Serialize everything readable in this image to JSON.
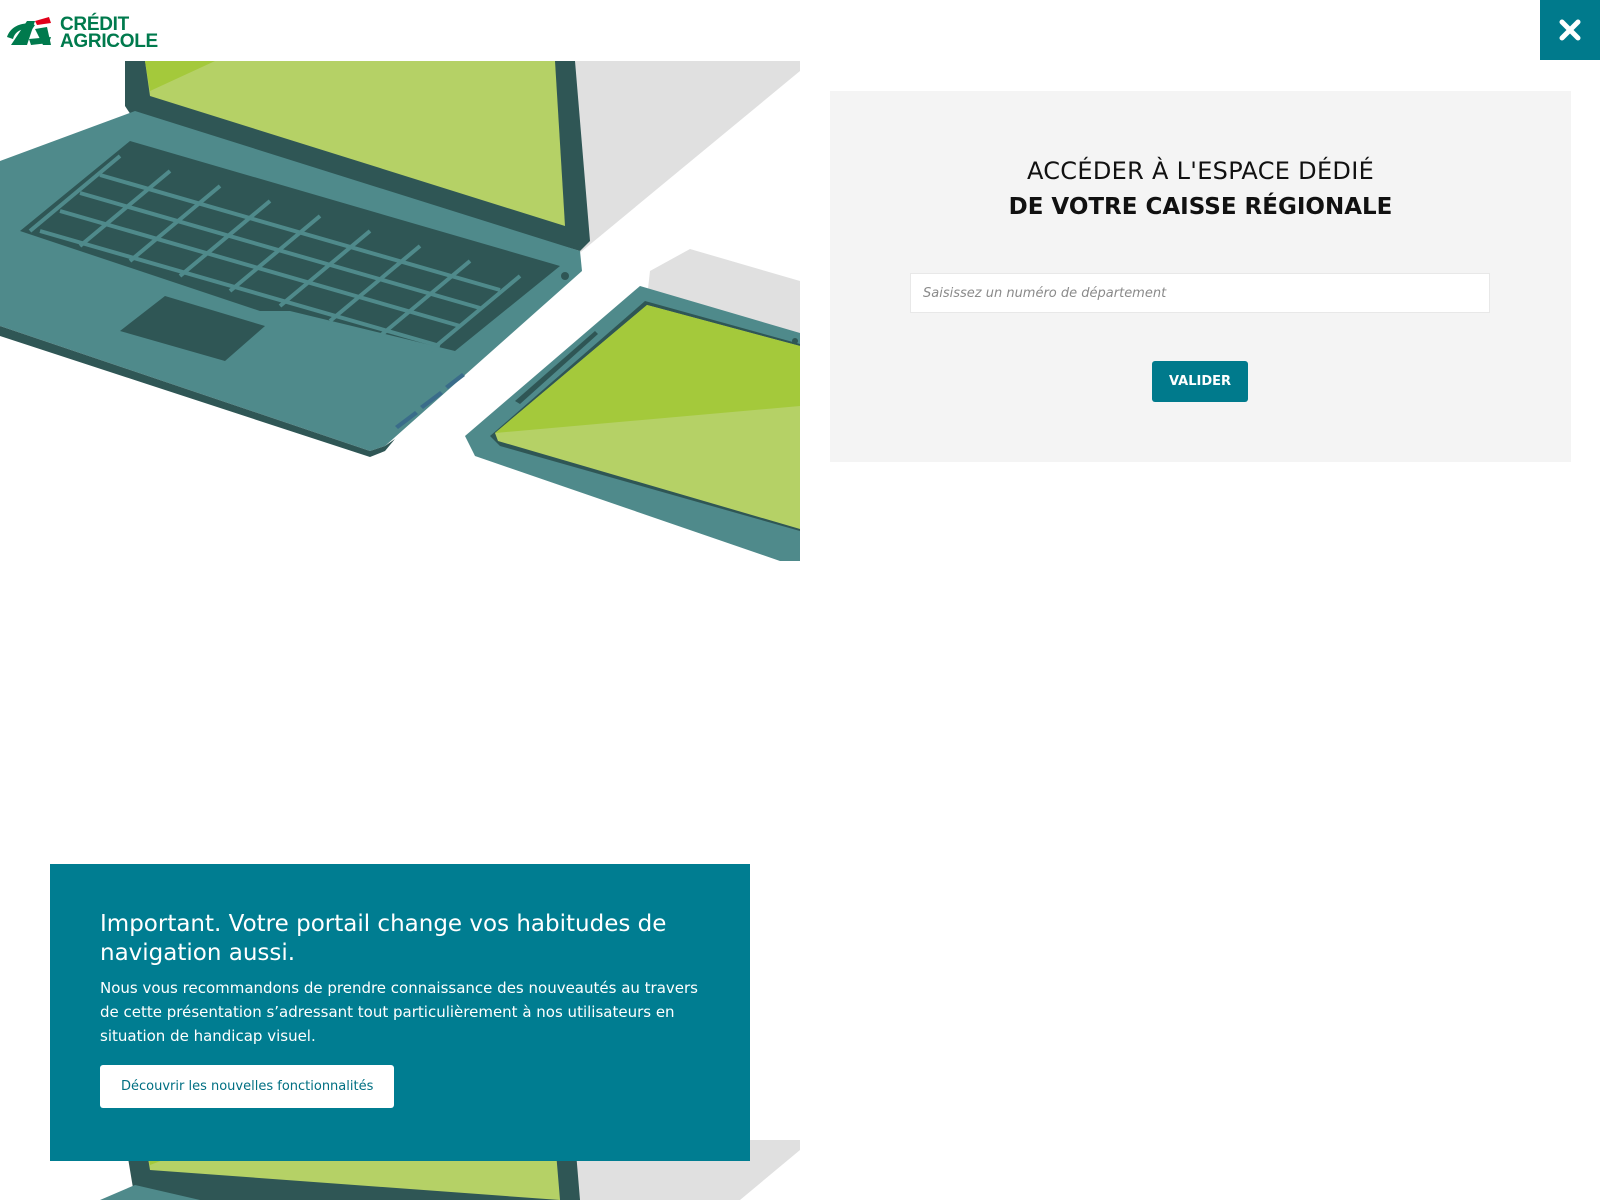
{
  "header": {
    "logo_line1": "CRÉDIT",
    "logo_line2": "AGRICOLE",
    "close_icon": "close-icon"
  },
  "panel": {
    "title_line1": "ACCÉDER À L'ESPACE DÉDIÉ",
    "title_line2": "DE VOTRE CAISSE RÉGIONALE",
    "input_placeholder": "Saisissez un numéro de département",
    "input_value": "",
    "submit_label": "VALIDER"
  },
  "notice": {
    "title": "Important. Votre portail change vos habitudes de navigation aussi.",
    "text": "Nous vous recommandons de prendre connaissance des nouveautés au travers de cette présentation s’adressant tout particulièrement à nos utilisateurs en situation de handicap visuel.",
    "button_label": "Découvrir les nouvelles fonctionnalités"
  },
  "colors": {
    "brand_teal": "#007a8c",
    "brand_green": "#007a4d",
    "screen_green": "#a4c93b",
    "device_body": "#4f8a8b"
  }
}
